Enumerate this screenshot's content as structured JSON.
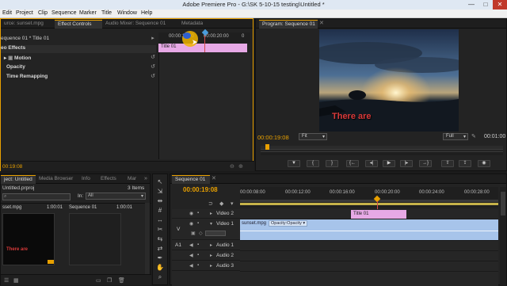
{
  "app": {
    "title": "Adobe Premiere Pro - G:\\SK 5-10-15 testing\\Untitled *"
  },
  "window_buttons": [
    "—",
    "□",
    "✕"
  ],
  "menu": [
    "Edit",
    "Project",
    "Clip",
    "Sequence",
    "Marker",
    "Title",
    "Window",
    "Help"
  ],
  "effect_controls": {
    "tabs": [
      "urce: sunset.mpg",
      "Effect Controls",
      "Audio Mixer: Sequence 01",
      "Metadata"
    ],
    "clip_path": "equence 01 * Title 01",
    "ruler": [
      "00:00:18:00",
      "00:00:20:00",
      "0"
    ],
    "clip_name": "Title 01",
    "section": "eo Effects",
    "effects": [
      "Motion",
      "Opacity",
      "Time Remapping"
    ],
    "timecode": "00:19:08"
  },
  "program": {
    "tab": "Program: Sequence 01",
    "caption": "There are",
    "timecode_left": "00:00:19:08",
    "fit": "Fit",
    "full": "Full",
    "timecode_right": "00:01:00"
  },
  "project": {
    "tabs": [
      "ject: Untitled",
      "Media Browser",
      "Info",
      "Effects",
      "Mar"
    ],
    "file": "Untitled.prproj",
    "items_count": "3 Items",
    "in_label": "In:",
    "in_value": "All",
    "items": [
      {
        "name": "sset.mpg",
        "dur": "1:00:01"
      },
      {
        "name": "Sequence 01",
        "dur": "1:00:01"
      }
    ],
    "thumb_caption": "There are"
  },
  "timeline": {
    "tab": "Sequence 01",
    "timecode": "00:00:19:08",
    "ruler": [
      "00:00:08:00",
      "00:00:12:00",
      "00:00:16:00",
      "00:00:20:00",
      "00:00:24:00",
      "00:00:28:00"
    ],
    "tracks": [
      {
        "name": "Video 2",
        "tag": ""
      },
      {
        "name": "Video 1",
        "tag": "V"
      },
      {
        "name": "Audio 1",
        "tag": "A1"
      },
      {
        "name": "Audio 2",
        "tag": ""
      },
      {
        "name": "Audio 3",
        "tag": ""
      }
    ],
    "title_clip": "Title 01",
    "video_clip": "sunset.mpg",
    "opacity_label": "Opacity:Opacity"
  },
  "colors": {
    "accent": "#e8a000",
    "title_clip": "#e7a9e6",
    "video_clip": "#a7c4ea",
    "playhead": "#d24a4a"
  }
}
